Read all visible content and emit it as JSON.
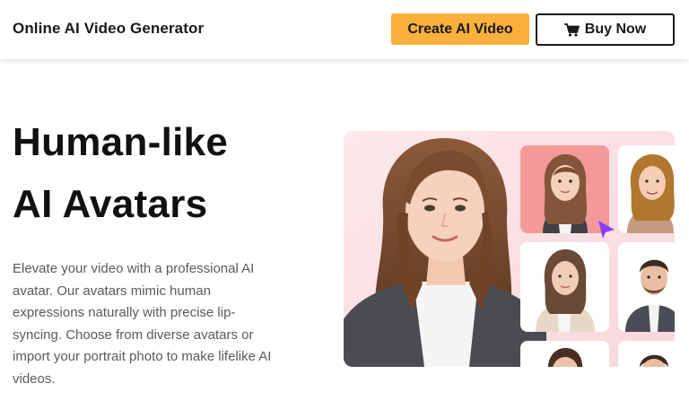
{
  "header": {
    "brand": "Online AI Video Generator",
    "create_button": "Create AI Video",
    "buy_button": "Buy Now",
    "cart_icon": "cart-icon"
  },
  "hero": {
    "headline_line1": "Human-like",
    "headline_line2": "AI Avatars",
    "description": "Elevate your video with a professional AI avatar. Our avatars mimic human expressions naturally with precise lip-syncing. Choose from diverse avatars or import your portrait photo to make lifelike AI videos."
  },
  "colors": {
    "accent": "#fbb03b",
    "cursor": "#8b3dff",
    "hero_bg": "#fbe3e6",
    "selected_tile": "#f39a98"
  }
}
